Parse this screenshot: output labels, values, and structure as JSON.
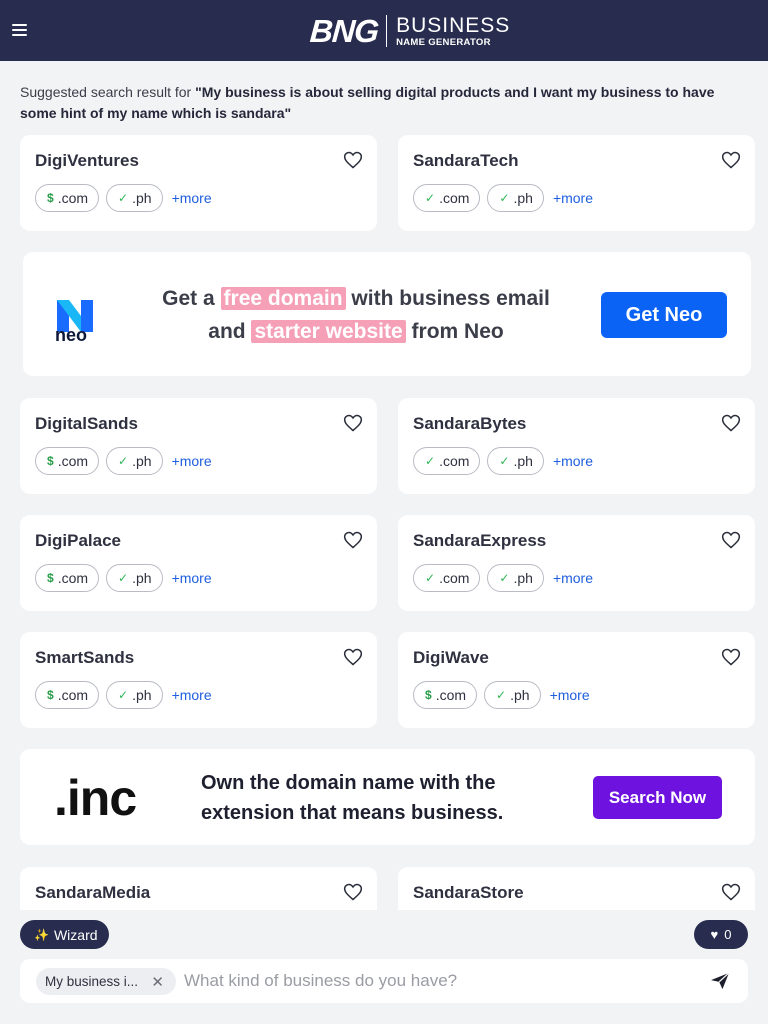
{
  "header": {
    "logo_mark": "BNG",
    "logo_line1": "BUSINESS",
    "logo_line2": "NAME GENERATOR"
  },
  "query": {
    "prefix": "Suggested search result for ",
    "text": "\"My business is about selling digital products and I want my business to have some hint of my name which is sandara\""
  },
  "cards": [
    {
      "name": "DigiVentures",
      "chips": [
        {
          "status": "premium",
          "tld": ".com"
        },
        {
          "status": "available",
          "tld": ".ph"
        }
      ],
      "more": "+more"
    },
    {
      "name": "SandaraTech",
      "chips": [
        {
          "status": "available",
          "tld": ".com"
        },
        {
          "status": "available",
          "tld": ".ph"
        }
      ],
      "more": "+more"
    },
    {
      "name": "DigitalSands",
      "chips": [
        {
          "status": "premium",
          "tld": ".com"
        },
        {
          "status": "available",
          "tld": ".ph"
        }
      ],
      "more": "+more"
    },
    {
      "name": "SandaraBytes",
      "chips": [
        {
          "status": "available",
          "tld": ".com"
        },
        {
          "status": "available",
          "tld": ".ph"
        }
      ],
      "more": "+more"
    },
    {
      "name": "DigiPalace",
      "chips": [
        {
          "status": "premium",
          "tld": ".com"
        },
        {
          "status": "available",
          "tld": ".ph"
        }
      ],
      "more": "+more"
    },
    {
      "name": "SandaraExpress",
      "chips": [
        {
          "status": "available",
          "tld": ".com"
        },
        {
          "status": "available",
          "tld": ".ph"
        }
      ],
      "more": "+more"
    },
    {
      "name": "SmartSands",
      "chips": [
        {
          "status": "premium",
          "tld": ".com"
        },
        {
          "status": "available",
          "tld": ".ph"
        }
      ],
      "more": "+more"
    },
    {
      "name": "DigiWave",
      "chips": [
        {
          "status": "premium",
          "tld": ".com"
        },
        {
          "status": "available",
          "tld": ".ph"
        }
      ],
      "more": "+more"
    },
    {
      "name": "SandaraMedia"
    },
    {
      "name": "SandaraStore"
    }
  ],
  "neo_ad": {
    "logo_word": "neo",
    "line1_a": "Get a",
    "line1_hl": "free domain",
    "line1_b": "with business email",
    "line2_a": "and",
    "line2_hl": "starter website",
    "line2_b": "from Neo",
    "button": "Get Neo",
    "accent": "#0b63f6",
    "highlight": "#f5a0b7"
  },
  "inc_ad": {
    "logo": ".inc",
    "line1": "Own the domain name with the",
    "line2": "extension that means business.",
    "button": "Search Now",
    "accent": "#6e12e0"
  },
  "bottom": {
    "wizard_label": "Wizard",
    "favorites_count": "0",
    "pill_text": "My business i...",
    "search_placeholder": "What kind of business do you have?"
  },
  "colors": {
    "nav_bg": "#282d4f",
    "page_bg": "#f2f3f5",
    "link": "#1f5fde",
    "available": "#2fb657"
  },
  "icons": {
    "menu": "hamburger-icon",
    "favorite": "heart-outline-icon",
    "available": "check-icon",
    "premium": "dollar-icon",
    "wizard": "wand-icon",
    "send": "send-icon",
    "clear": "close-icon"
  }
}
